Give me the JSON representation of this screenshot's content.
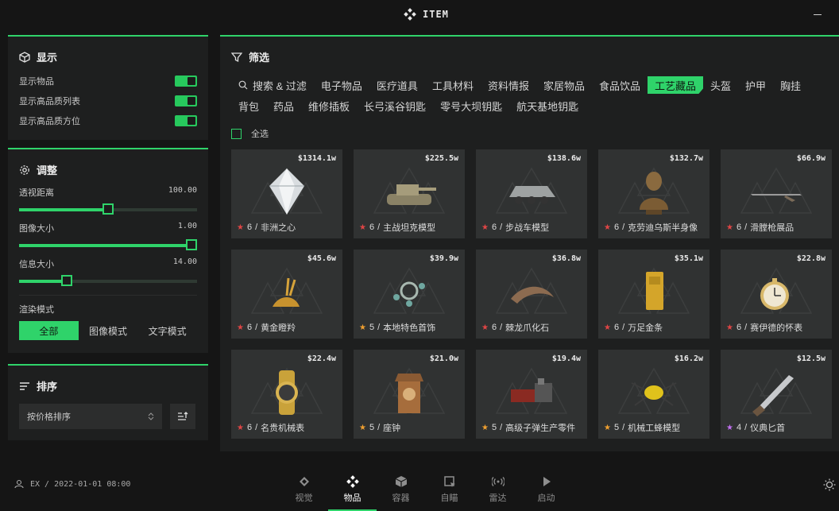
{
  "app": {
    "title": "ITEM"
  },
  "colors": {
    "accent": "#2fd36a",
    "panel": "#1e1f1f",
    "card": "#303232",
    "background": "#151515"
  },
  "display": {
    "title": "显示",
    "toggles": [
      {
        "label": "显示物品",
        "on": true
      },
      {
        "label": "显示高品质列表",
        "on": true
      },
      {
        "label": "显示高品质方位",
        "on": true
      }
    ]
  },
  "adjust": {
    "title": "调整",
    "sliders": [
      {
        "label": "透视距离",
        "value": "100.00",
        "fraction": 0.5
      },
      {
        "label": "图像大小",
        "value": "1.00",
        "fraction": 1.0
      },
      {
        "label": "信息大小",
        "value": "14.00",
        "fraction": 0.27
      }
    ],
    "render_mode_label": "渲染模式",
    "render_modes": [
      "全部",
      "图像模式",
      "文字模式"
    ],
    "render_mode_selected": 0
  },
  "sort": {
    "title": "排序",
    "selected": "按价格排序"
  },
  "user": {
    "info": "EX / 2022-01-01 08:00"
  },
  "filter": {
    "title": "筛选",
    "search_label": "搜索 & 过滤",
    "categories": [
      "电子物品",
      "医疗道具",
      "工具材料",
      "资料情报",
      "家居物品",
      "食品饮品",
      "工艺藏品",
      "头盔",
      "护甲",
      "胸挂",
      "背包",
      "药品",
      "维修插板",
      "长弓溪谷钥匙",
      "零号大坝钥匙",
      "航天基地钥匙"
    ],
    "active_category": 6,
    "select_all": "全选"
  },
  "items": [
    {
      "price": "$1314.1w",
      "rarity": "6",
      "name": "非洲之心",
      "star_color": "#e04545",
      "icon": "diamond-icon"
    },
    {
      "price": "$225.5w",
      "rarity": "6",
      "name": "主战坦克模型",
      "star_color": "#e04545",
      "icon": "tank-icon"
    },
    {
      "price": "$138.6w",
      "rarity": "6",
      "name": "步战车模型",
      "star_color": "#e04545",
      "icon": "armored-vehicle-icon"
    },
    {
      "price": "$132.7w",
      "rarity": "6",
      "name": "克劳迪乌斯半身像",
      "star_color": "#e04545",
      "icon": "bust-icon"
    },
    {
      "price": "$66.9w",
      "rarity": "6",
      "name": "滑膛枪展品",
      "star_color": "#e04545",
      "icon": "musket-icon"
    },
    {
      "price": "$45.6w",
      "rarity": "6",
      "name": "黄金瞪羚",
      "star_color": "#e04545",
      "icon": "gazelle-icon"
    },
    {
      "price": "$39.9w",
      "rarity": "5",
      "name": "本地特色首饰",
      "star_color": "#f0a030",
      "icon": "jewelry-icon"
    },
    {
      "price": "$36.8w",
      "rarity": "6",
      "name": "棘龙爪化石",
      "star_color": "#e04545",
      "icon": "claw-fossil-icon"
    },
    {
      "price": "$35.1w",
      "rarity": "6",
      "name": "万足金条",
      "star_color": "#e04545",
      "icon": "gold-bar-icon"
    },
    {
      "price": "$22.8w",
      "rarity": "6",
      "name": "赛伊德的怀表",
      "star_color": "#e04545",
      "icon": "pocket-watch-icon"
    },
    {
      "price": "$22.4w",
      "rarity": "6",
      "name": "名贵机械表",
      "star_color": "#e04545",
      "icon": "wristwatch-icon"
    },
    {
      "price": "$21.0w",
      "rarity": "5",
      "name": "座钟",
      "star_color": "#f0a030",
      "icon": "table-clock-icon"
    },
    {
      "price": "$19.4w",
      "rarity": "5",
      "name": "高级子弹生产零件",
      "star_color": "#f0a030",
      "icon": "machine-parts-icon"
    },
    {
      "price": "$16.2w",
      "rarity": "5",
      "name": "机械工蜂模型",
      "star_color": "#f0a030",
      "icon": "mechanical-bee-icon"
    },
    {
      "price": "$12.5w",
      "rarity": "4",
      "name": "仪典匕首",
      "star_color": "#c070f0",
      "icon": "dagger-icon"
    }
  ],
  "nav": {
    "items": [
      {
        "label": "视觉",
        "icon": "eye-diamond-icon"
      },
      {
        "label": "物品",
        "icon": "item-diamond-icon"
      },
      {
        "label": "容器",
        "icon": "cube-icon"
      },
      {
        "label": "自瞄",
        "icon": "aim-icon"
      },
      {
        "label": "雷达",
        "icon": "radar-icon"
      },
      {
        "label": "启动",
        "icon": "play-icon"
      }
    ],
    "active": 1
  }
}
